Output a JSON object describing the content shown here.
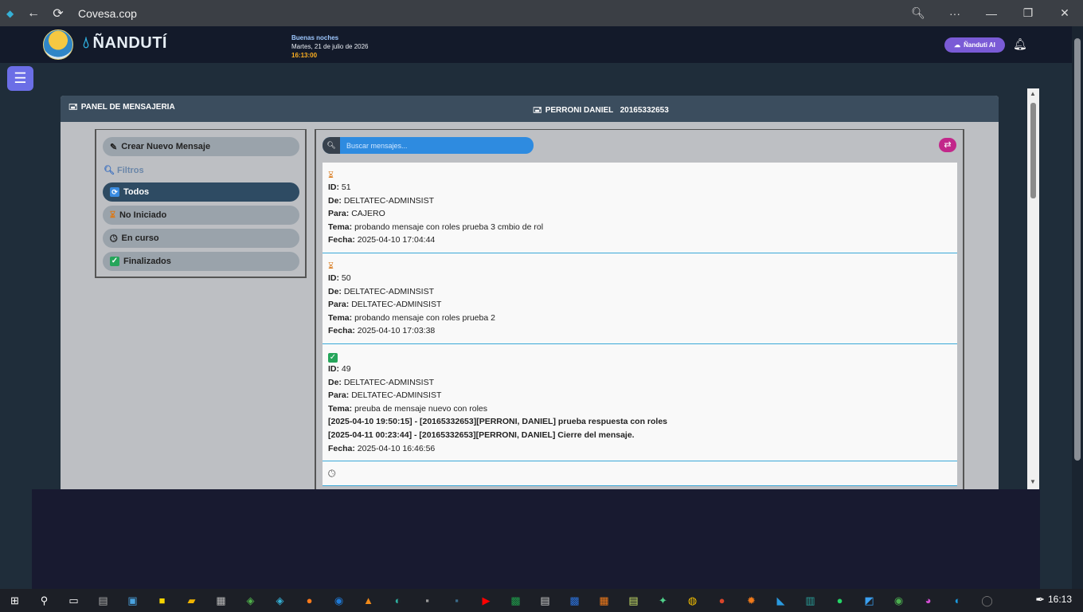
{
  "browser": {
    "url": "Covesa.cop",
    "back_glyph": "←",
    "reload_glyph": "⟳",
    "zoom_glyph": "🔍︎",
    "more_glyph": "···",
    "minimize_glyph": "—",
    "restore_glyph": "❐",
    "close_glyph": "✕"
  },
  "header": {
    "brand": "ÑANDUTÍ",
    "greeting": "Buenas noches",
    "date": "Martes, 21 de julio de 2026",
    "time": "16:13:00",
    "ai_button": "Ñanduti AI",
    "bell_glyph": "🔔︎"
  },
  "menu_glyph": "☰",
  "panel": {
    "title": "PANEL DE MENSAJERIA",
    "user_name": "PERRONI DANIEL",
    "user_id": "20165332653"
  },
  "sidebar": {
    "new_message": "Crear Nuevo Mensaje",
    "filters_label": "Filtros",
    "filters": [
      {
        "label": "Todos",
        "active": true,
        "icon": "sync-icon"
      },
      {
        "label": "No Iniciado",
        "active": false,
        "icon": "hourglass-icon"
      },
      {
        "label": "En curso",
        "active": false,
        "icon": "clock-icon"
      },
      {
        "label": "Finalizados",
        "active": false,
        "icon": "check-icon"
      }
    ]
  },
  "search": {
    "placeholder": "Buscar mensajes..."
  },
  "labels": {
    "id": "ID:",
    "from": "De:",
    "to": "Para:",
    "subject": "Tema:",
    "date": "Fecha:"
  },
  "messages": [
    {
      "status": "hourglass",
      "id": "51",
      "from": "DELTATEC-ADMINSIST",
      "to": "CAJERO",
      "subject": "probando mensaje con roles prueba 3 cmbio de rol",
      "responses": [],
      "date": "2025-04-10 17:04:44"
    },
    {
      "status": "hourglass",
      "id": "50",
      "from": "DELTATEC-ADMINSIST",
      "to": "DELTATEC-ADMINSIST",
      "subject": "probando mensaje con roles prueba 2",
      "responses": [],
      "date": "2025-04-10 17:03:38"
    },
    {
      "status": "check",
      "id": "49",
      "from": "DELTATEC-ADMINSIST",
      "to": "DELTATEC-ADMINSIST",
      "subject": "preuba de mensaje nuevo con roles",
      "responses": [
        "[2025-04-10 19:50:15] - [20165332653][PERRONI, DANIEL] prueba respuesta con roles",
        "[2025-04-11 00:23:44] - [20165332653][PERRONI, DANIEL] Cierre del mensaje."
      ],
      "date": "2025-04-10 16:46:56"
    },
    {
      "status": "clock",
      "id": "",
      "from": "",
      "to": "",
      "subject": "",
      "responses": [],
      "date": ""
    }
  ],
  "taskbar": {
    "time": "16:13"
  }
}
